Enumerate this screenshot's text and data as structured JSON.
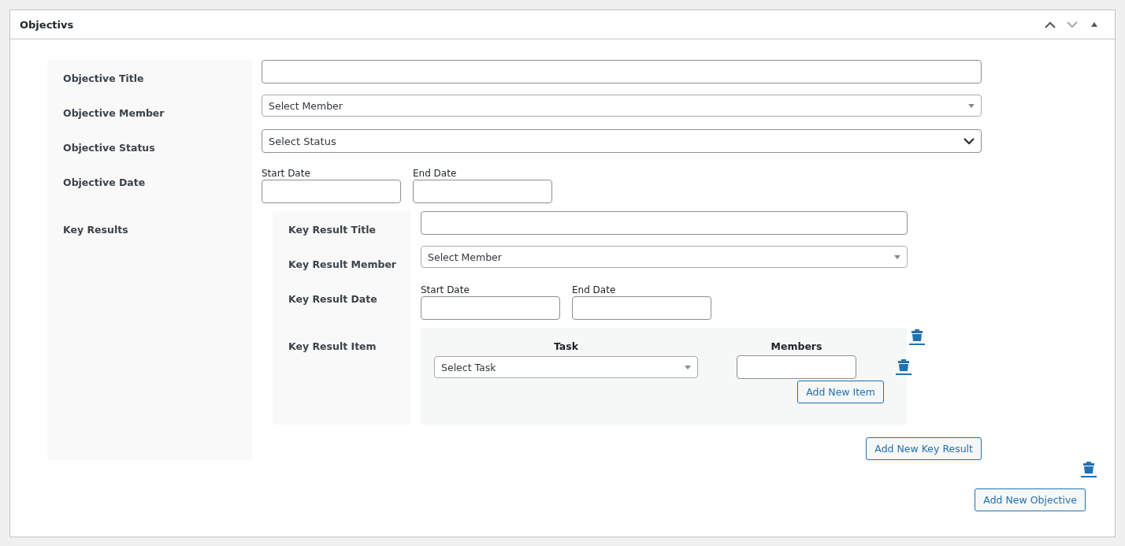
{
  "panel": {
    "title": "Objectivs"
  },
  "objective_fields": [
    {
      "kind": "text",
      "label": "Objective Title"
    },
    {
      "kind": "dropdown",
      "label": "Objective Member",
      "value": "Select Member"
    },
    {
      "kind": "chevron",
      "label": "Objective Status",
      "value": "Select Status"
    },
    {
      "kind": "dates",
      "label": "Objective Date",
      "start_label": "Start Date",
      "end_label": "End Date"
    }
  ],
  "key_results": {
    "label": "Key Results",
    "fields": [
      {
        "kind": "text",
        "label": "Key Result Title"
      },
      {
        "kind": "dropdown",
        "label": "Key Result Member",
        "value": "Select Member"
      },
      {
        "kind": "dates",
        "label": "Key Result Date",
        "start_label": "Start Date",
        "end_label": "End Date"
      }
    ],
    "item": {
      "label": "Key Result Item",
      "task_heading": "Task",
      "members_heading": "Members",
      "task_value": "Select Task",
      "add_item": "Add New Item"
    },
    "add_key_result": "Add New Key Result"
  },
  "add_objective": "Add New Objective"
}
